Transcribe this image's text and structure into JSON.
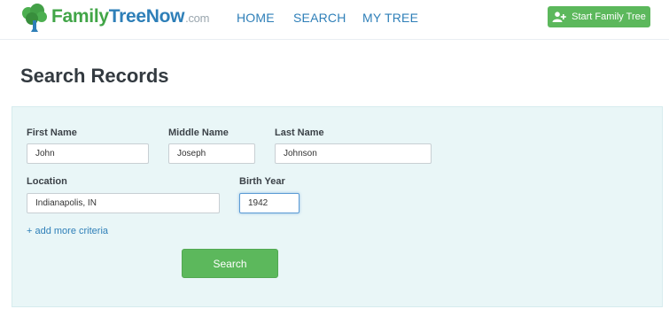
{
  "header": {
    "logo": {
      "part1": "Family",
      "part2": "TreeNow",
      "part3": ".com",
      "icon": "tree-icon"
    },
    "nav": [
      {
        "label": "HOME"
      },
      {
        "label": "SEARCH"
      },
      {
        "label": "MY TREE"
      }
    ],
    "start_button": {
      "label": "Start Family Tree",
      "icon": "add-user-icon"
    }
  },
  "main": {
    "title": "Search Records",
    "form": {
      "first_name": {
        "label": "First Name",
        "value": "John"
      },
      "middle_name": {
        "label": "Middle Name",
        "value": "Joseph"
      },
      "last_name": {
        "label": "Last Name",
        "value": "Johnson"
      },
      "location": {
        "label": "Location",
        "value": "Indianapolis, IN"
      },
      "birth_year": {
        "label": "Birth Year",
        "value": "1942"
      },
      "more_criteria": "+ add more criteria",
      "search_button": "Search"
    }
  },
  "colors": {
    "accent_green": "#5cb85c",
    "link_blue": "#2e7fb8",
    "panel_bg": "#e9f6f7"
  }
}
